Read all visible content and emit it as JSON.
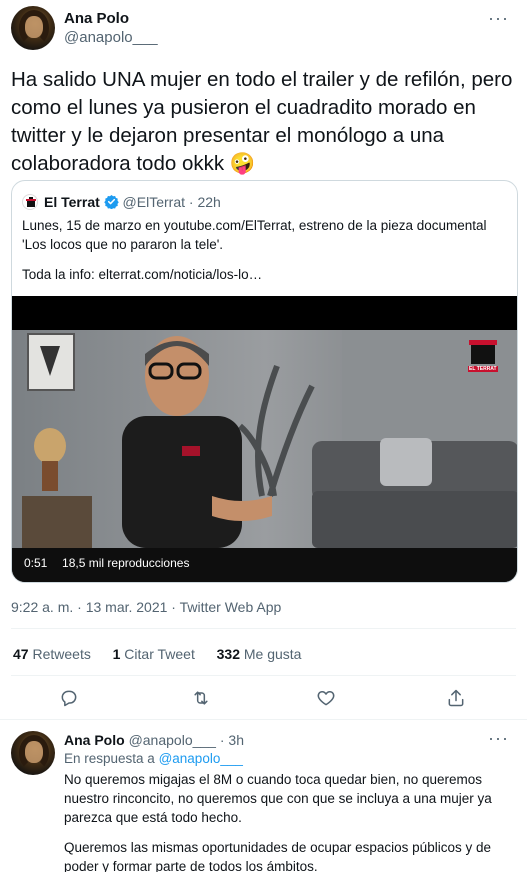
{
  "tweet": {
    "author_name": "Ana Polo",
    "author_handle": "@anapolo___",
    "more_glyph": "···",
    "text": "Ha salido UNA mujer en todo el trailer y de refilón, pero como el lunes ya pusieron el cuadradito morado en twitter y le dejaron presentar el monólogo a una colaboradora todo okkk 🤪",
    "timestamp": "9:22 a. m. · 13 mar. 2021 · Twitter Web App"
  },
  "quote": {
    "author_name": "El Terrat",
    "author_handle": "@ElTerrat",
    "time": "· 22h",
    "text_line1": "Lunes, 15 de marzo en youtube.com/ElTerrat, estreno de la pieza documental 'Los locos que no pararon la tele'.",
    "text_line2": "Toda la info: elterrat.com/noticia/los-lo…",
    "video_duration": "0:51",
    "video_views": "18,5 mil reproducciones",
    "video_logo": "EL TERRAT"
  },
  "stats": {
    "retweets_count": "47",
    "retweets_label": "Retweets",
    "quotes_count": "1",
    "quotes_label": "Citar Tweet",
    "likes_count": "332",
    "likes_label": "Me gusta"
  },
  "reply": {
    "author_name": "Ana Polo",
    "author_handle": "@anapolo___",
    "time": "· 3h",
    "more_glyph": "···",
    "in_reply_prefix": "En respuesta a",
    "in_reply_handle": "@anapolo___",
    "para1": "No queremos migajas el 8M o cuando toca quedar bien, no queremos nuestro rinconcito, no queremos que con que se incluya a una mujer ya parezca que está todo hecho.",
    "para2": "Queremos las mismas oportunidades de ocupar espacios públicos y de poder y formar parte de todos los ámbitos."
  },
  "colors": {
    "accent": "#1d9bf0",
    "text_primary": "#0f1419",
    "text_secondary": "#536471",
    "border": "#cfd9de"
  },
  "icons": [
    "reply-icon",
    "retweet-icon",
    "like-icon",
    "share-icon",
    "verified-icon",
    "more-icon"
  ]
}
